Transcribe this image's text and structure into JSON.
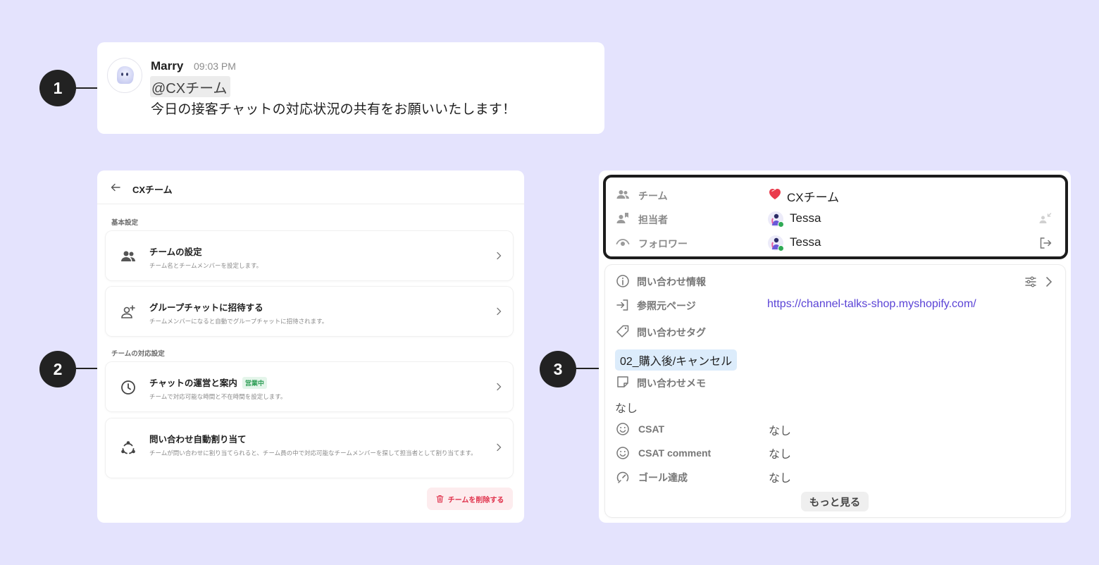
{
  "markers": [
    "1",
    "2",
    "3"
  ],
  "message": {
    "author": "Marry",
    "time": "09:03 PM",
    "mention": "@CXチーム",
    "text": "今日の接客チャットの対応状況の共有をお願いいたします！"
  },
  "settings": {
    "title": "CXチーム",
    "sections": [
      {
        "label": "基本設定"
      },
      {
        "label": "チームの対応設定"
      }
    ],
    "items": [
      {
        "title": "チームの設定",
        "desc": "チーム名とチームメンバーを設定します。",
        "icon": "team-icon"
      },
      {
        "title": "グループチャットに招待する",
        "desc": "チームメンバーになると自動でグループチャットに招待されます。",
        "icon": "add-person-icon"
      },
      {
        "title": "チャットの運営と案内",
        "badge": "営業中",
        "desc": "チームで対応可能な時間と不在時間を設定します。",
        "icon": "clock-icon"
      },
      {
        "title": "問い合わせ自動割り当て",
        "desc": "チームが問い合わせに割り当てられると、チーム員の中で対応可能なチームメンバーを探して担当者として割り当てます。",
        "icon": "assign-cycle-icon"
      }
    ],
    "delete_label": "チームを削除する",
    "colors": {
      "badge_bg": "#e4f5ea",
      "badge_text": "#2d9d55",
      "delete_bg": "#fdecee",
      "delete_text": "#e0324c"
    }
  },
  "info": {
    "team_label": "チーム",
    "team_value": "CXチーム",
    "assignee_label": "担当者",
    "assignee_value": "Tessa",
    "follower_label": "フォロワー",
    "follower_value": "Tessa",
    "inquiry_info_label": "問い合わせ情報",
    "referrer_label": "参照元ページ",
    "referrer_value": "https://channel-talks-shop.myshopify.com/",
    "tag_label": "問い合わせタグ",
    "tag_value": "02_購入後/キャンセル",
    "memo_label": "問い合わせメモ",
    "memo_value": "なし",
    "csat_label": "CSAT",
    "csat_value": "なし",
    "csat_comment_label": "CSAT comment",
    "csat_comment_value": "なし",
    "goal_label": "ゴール達成",
    "goal_value": "なし",
    "more_label": "もっと見る",
    "colors": {
      "link": "#5a43d6",
      "tag_bg": "#dcecfb",
      "online": "#2faa55"
    }
  },
  "background": "#e4e3fd"
}
